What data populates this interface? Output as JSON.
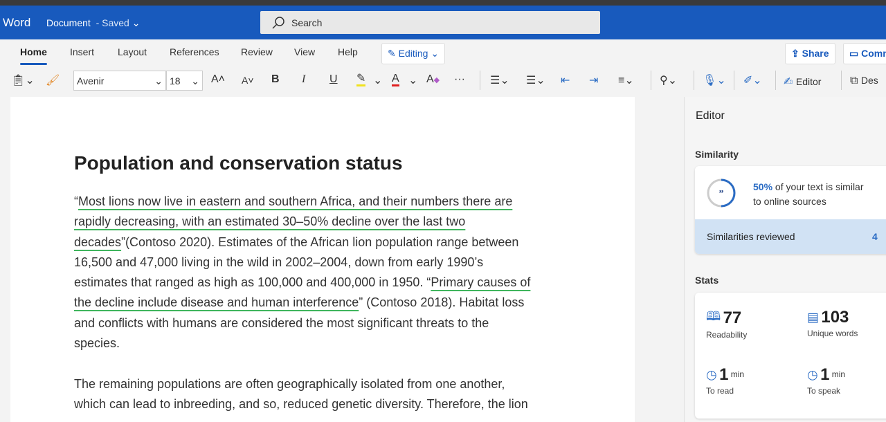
{
  "titlebar": {
    "app": "Word",
    "document": "Document",
    "status": "- Saved",
    "search_placeholder": "Search"
  },
  "tabs": [
    "Home",
    "Insert",
    "Layout",
    "References",
    "Review",
    "View",
    "Help"
  ],
  "active_tab": "Home",
  "editing_mode": "Editing",
  "actions": {
    "share": "Share",
    "comments": "Comm"
  },
  "toolbar": {
    "font": "Avenir",
    "size": "18",
    "editor": "Editor",
    "designer": "Des"
  },
  "document": {
    "heading": "Population and conservation status",
    "paragraph1": [
      [
        {
          "t": "“",
          "q": false
        },
        {
          "t": "Most lions now live in eastern and southern Africa, and their numbers there are",
          "q": true
        }
      ],
      [
        {
          "t": "rapidly decreasing, with an estimated 30–50% decline over the last two",
          "q": true
        }
      ],
      [
        {
          "t": "decades",
          "q": true
        },
        {
          "t": "”(Contoso 2020). Estimates of the African lion population range between",
          "q": false
        }
      ],
      [
        {
          "t": "16,500 and 47,000 living in the wild in 2002–2004, down from early 1990’s",
          "q": false
        }
      ],
      [
        {
          "t": "estimates that ranged as high as 100,000 and 400,000 in 1950. “",
          "q": false
        },
        {
          "t": "Primary causes of",
          "q": true
        }
      ],
      [
        {
          "t": "the decline include disease and human interference",
          "q": true
        },
        {
          "t": "” (Contoso 2018). Habitat loss",
          "q": false
        }
      ],
      [
        {
          "t": "and conflicts with humans are considered the most significant threats to the",
          "q": false
        }
      ],
      [
        {
          "t": "species.",
          "q": false
        }
      ]
    ],
    "paragraph2": [
      [
        {
          "t": "The remaining populations are often geographically isolated from one another,",
          "q": false
        }
      ],
      [
        {
          "t": "which can lead to inbreeding, and so, reduced genetic diversity. Therefore, the lion",
          "q": false
        }
      ]
    ]
  },
  "editor_pane": {
    "title": "Editor",
    "similarity": {
      "heading": "Similarity",
      "percent": "50%",
      "percent_value": 50,
      "text1": " of your text is similar",
      "text2": "to online sources",
      "reviewed_label": "Similarities reviewed",
      "reviewed_count": "4"
    },
    "stats": {
      "heading": "Stats",
      "items": [
        {
          "value": "77",
          "unit": "",
          "label": "Readability",
          "icon": "book-open-icon"
        },
        {
          "value": "103",
          "unit": "",
          "label": "Unique words",
          "icon": "book-icon"
        },
        {
          "value": "1",
          "unit": "min",
          "label": "To read",
          "icon": "clock-icon"
        },
        {
          "value": "1",
          "unit": "min",
          "label": "To speak",
          "icon": "clock-icon"
        }
      ]
    }
  },
  "colors": {
    "brand": "#185abd",
    "quote_underline": "#3fb55d",
    "accent": "#2b6cc4"
  }
}
